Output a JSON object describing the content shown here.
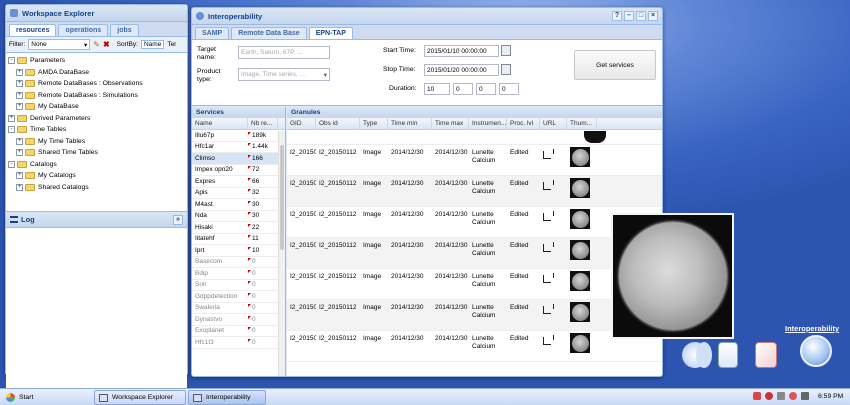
{
  "workspace": {
    "title": "Workspace Explorer",
    "tabs": [
      "resources",
      "operations",
      "jobs"
    ],
    "filter_label": "Filter:",
    "filter_value": "None",
    "sortby_label": "SortBy:",
    "sort_options": [
      "Name",
      "Ter"
    ],
    "tree": [
      {
        "label": "Parameters",
        "level": 0,
        "toggle": "-"
      },
      {
        "label": "AMDA DataBase",
        "level": 1,
        "toggle": "+"
      },
      {
        "label": "Remote DataBases : Observations",
        "level": 1,
        "toggle": "+"
      },
      {
        "label": "Remote DataBases : Simulations",
        "level": 1,
        "toggle": "+"
      },
      {
        "label": "My DataBase",
        "level": 1,
        "toggle": "+"
      },
      {
        "label": "Derived Parameters",
        "level": 0,
        "toggle": "+"
      },
      {
        "label": "Time Tables",
        "level": 0,
        "toggle": "-"
      },
      {
        "label": "My Time Tables",
        "level": 1,
        "toggle": "+"
      },
      {
        "label": "Shared Time Tables",
        "level": 1,
        "toggle": "+"
      },
      {
        "label": "Catalogs",
        "level": 0,
        "toggle": "-"
      },
      {
        "label": "My Catalogs",
        "level": 1,
        "toggle": "+"
      },
      {
        "label": "Shared Catalogs",
        "level": 1,
        "toggle": "+"
      }
    ],
    "log_title": "Log"
  },
  "interop": {
    "title": "Interoperability",
    "tabs": [
      "SAMP",
      "Remote Data Base",
      "EPN-TAP"
    ],
    "active_tab": 2,
    "target_label": "Target name:",
    "target_placeholder": "Earth, Saturn, 67P, ...",
    "product_label": "Product type:",
    "product_placeholder": "Image, Time series, ...",
    "start_label": "Start Time:",
    "start_value": "2015/01/10 00:00:00",
    "stop_label": "Stop Time:",
    "stop_value": "2015/01/20 00:00:00",
    "duration_label": "Duration:",
    "duration_values": [
      "10",
      "0",
      "0",
      "0"
    ],
    "get_services": "Get services",
    "services_title": "Services",
    "services_cols": [
      "Name",
      "Nb re..."
    ],
    "services": [
      {
        "name": "Illu67p",
        "nb": "189k",
        "active": true
      },
      {
        "name": "Hfc1ar",
        "nb": "1.44k",
        "active": true
      },
      {
        "name": "Climso",
        "nb": "166",
        "active": true,
        "selected": true
      },
      {
        "name": "Impex opn20",
        "nb": "72",
        "active": true
      },
      {
        "name": "Expres",
        "nb": "66",
        "active": true
      },
      {
        "name": "Apis",
        "nb": "32",
        "active": true
      },
      {
        "name": "M4ast",
        "nb": "30",
        "active": true
      },
      {
        "name": "Nda",
        "nb": "30",
        "active": true
      },
      {
        "name": "Hisaki",
        "nb": "22",
        "active": true
      },
      {
        "name": "Iitatehf",
        "nb": "11",
        "active": true
      },
      {
        "name": "Iprt",
        "nb": "10",
        "active": true
      },
      {
        "name": "Basecom",
        "nb": "0",
        "active": false
      },
      {
        "name": "Bdip",
        "nb": "0",
        "active": false
      },
      {
        "name": "Soir",
        "nb": "0",
        "active": false
      },
      {
        "name": "Gdppdetection",
        "nb": "0",
        "active": false
      },
      {
        "name": "Swaleria",
        "nb": "0",
        "active": false
      },
      {
        "name": "Dynastvo",
        "nb": "0",
        "active": false
      },
      {
        "name": "Exoplanet",
        "nb": "0",
        "active": false
      },
      {
        "name": "Hfc1t3",
        "nb": "0",
        "active": false
      }
    ],
    "granules_title": "Granules",
    "granule_cols": [
      "GID",
      "Obs id",
      "Type",
      "Time min",
      "Time max",
      "Instrumen...",
      "Proc. lvl",
      "URL",
      "Thum..."
    ],
    "granules": [
      {
        "gid": "I2_20150",
        "obs": "I2_20150112",
        "type": "Image",
        "tmin": "2014/12/30",
        "tmax": "2014/12/30",
        "inst1": "Lunette",
        "inst2": "Calcium",
        "proc": "Edited"
      },
      {
        "gid": "I2_20150",
        "obs": "I2_20150112",
        "type": "Image",
        "tmin": "2014/12/30",
        "tmax": "2014/12/30",
        "inst1": "Lunette",
        "inst2": "Calcium",
        "proc": "Edited"
      },
      {
        "gid": "I2_20150",
        "obs": "I2_20150112",
        "type": "Image",
        "tmin": "2014/12/30",
        "tmax": "2014/12/30",
        "inst1": "Lunette",
        "inst2": "Calcium",
        "proc": "Edited"
      },
      {
        "gid": "I2_20150",
        "obs": "I2_20150112",
        "type": "Image",
        "tmin": "2014/12/30",
        "tmax": "2014/12/30",
        "inst1": "Lunette",
        "inst2": "Calcium",
        "proc": "Edited"
      },
      {
        "gid": "I2_20150",
        "obs": "I2_20150112",
        "type": "Image",
        "tmin": "2014/12/30",
        "tmax": "2014/12/30",
        "inst1": "Lunette",
        "inst2": "Calcium",
        "proc": "Edited"
      },
      {
        "gid": "I2_20150",
        "obs": "I2_20150112",
        "type": "Image",
        "tmin": "2014/12/30",
        "tmax": "2014/12/30",
        "inst1": "Lunette",
        "inst2": "Calcium",
        "proc": "Edited"
      },
      {
        "gid": "I2_20150",
        "obs": "I2_20150112",
        "type": "Image",
        "tmin": "2014/12/30",
        "tmax": "2014/12/30",
        "inst1": "Lunette",
        "inst2": "Calcium",
        "proc": "Edited"
      }
    ]
  },
  "desktop": {
    "interop_label": "Interoperability"
  },
  "taskbar": {
    "start": "Start",
    "items": [
      "Workspace Explorer",
      "Interoperability"
    ],
    "clock": "6:59 PM"
  }
}
